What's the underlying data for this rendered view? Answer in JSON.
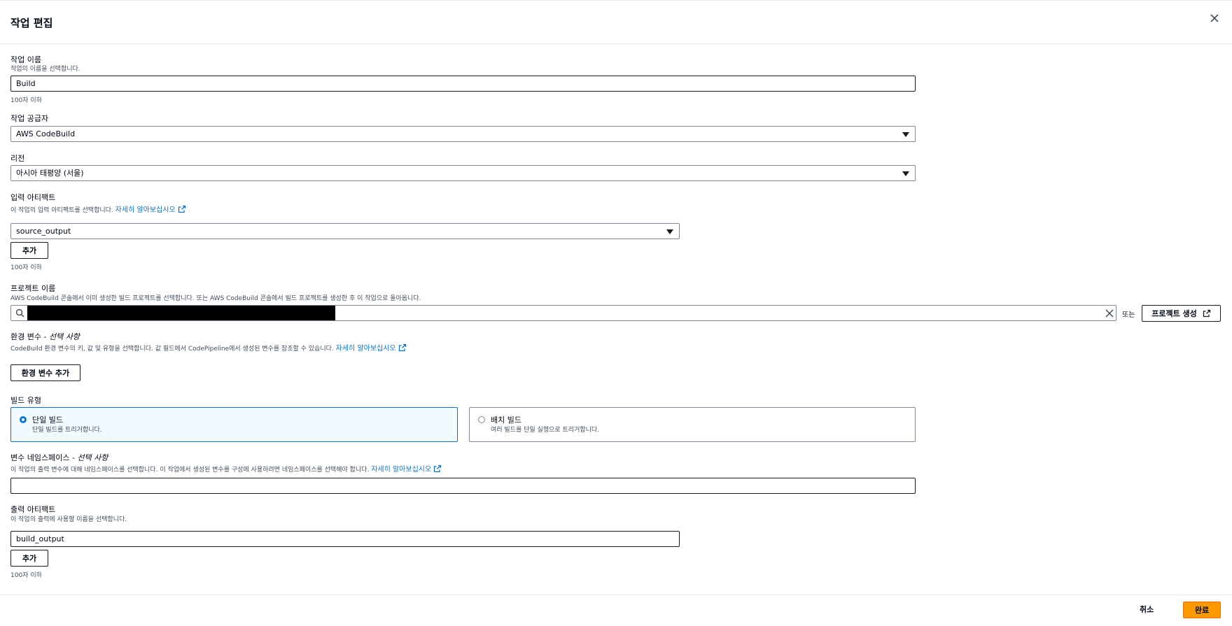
{
  "modal": {
    "title": "작업 편집"
  },
  "action_name": {
    "label": "작업 이름",
    "description": "작업의 이름을 선택합니다.",
    "value": "Build",
    "hint": "100자 이하"
  },
  "action_provider": {
    "label": "작업 공급자",
    "value": "AWS CodeBuild"
  },
  "region": {
    "label": "리전",
    "value": "아시아 태평양 (서울)"
  },
  "input_artifacts": {
    "label": "입력 아티팩트",
    "description": "이 작업의 입력 아티팩트를 선택합니다.",
    "learn_more": "자세히 알아보십시오",
    "value": "source_output",
    "add_label": "추가",
    "hint": "100자 이하"
  },
  "project_name": {
    "label": "프로젝트 이름",
    "description": "AWS CodeBuild 콘솔에서 이미 생성한 빌드 프로젝트를 선택합니다. 또는 AWS CodeBuild 콘솔에서 빌드 프로젝트를 생성한 후 이 작업으로 돌아옵니다.",
    "or_label": "또는",
    "create_label": "프로젝트 생성"
  },
  "env_vars": {
    "label": "환경 변수 - ",
    "optional": "선택 사항",
    "description": "CodeBuild 환경 변수의 키, 값 및 유형을 선택합니다. 값 필드에서 CodePipeline에서 생성된 변수를 참조할 수 있습니다.",
    "learn_more": "자세히 알아보십시오",
    "add_label": "환경 변수 추가"
  },
  "build_type": {
    "label": "빌드 유형",
    "options": [
      {
        "title": "단일 빌드",
        "desc": "단일 빌드를 트리거합니다.",
        "selected": true
      },
      {
        "title": "배치 빌드",
        "desc": "여러 빌드를 단일 실행으로 트리거합니다.",
        "selected": false
      }
    ]
  },
  "namespace": {
    "label": "변수 네임스페이스 - ",
    "optional": "선택 사항",
    "description": "이 작업의 출력 변수에 대해 네임스페이스를 선택합니다. 이 작업에서 생성된 변수를 구성에 사용하려면 네임스페이스를 선택해야 합니다.",
    "learn_more": "자세히 알아보십시오",
    "value": ""
  },
  "output_artifacts": {
    "label": "출력 아티팩트",
    "description": "이 작업의 출력에 사용할 이름을 선택합니다.",
    "value": "build_output",
    "add_label": "추가",
    "hint": "100자 이하"
  },
  "footer": {
    "cancel_label": "취소",
    "done_label": "완료"
  },
  "colors": {
    "link": "#0972d3",
    "primary": "#ff9900",
    "selected_bg": "#f1faff"
  },
  "icons": [
    "close-icon",
    "external-link-icon",
    "search-icon",
    "clear-icon",
    "chevron-down-icon"
  ]
}
